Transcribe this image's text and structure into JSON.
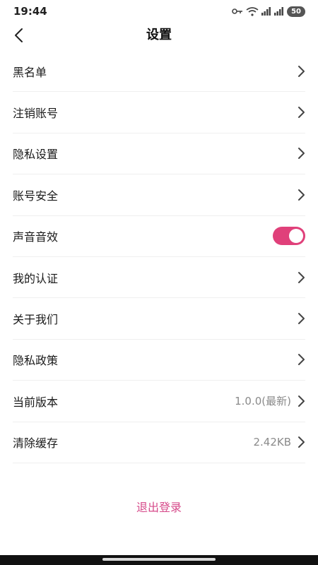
{
  "status_bar": {
    "time": "19:44",
    "battery": "50"
  },
  "nav": {
    "title": "设置"
  },
  "settings": {
    "items": [
      {
        "label": "黑名单"
      },
      {
        "label": "注销账号"
      },
      {
        "label": "隐私设置"
      },
      {
        "label": "账号安全"
      },
      {
        "label": "声音音效",
        "toggle_on": true
      },
      {
        "label": "我的认证"
      },
      {
        "label": "关于我们"
      },
      {
        "label": "隐私政策"
      },
      {
        "label": "当前版本",
        "value": "1.0.0(最新)"
      },
      {
        "label": "清除缓存",
        "value": "2.42KB"
      }
    ]
  },
  "logout": {
    "label": "退出登录"
  },
  "colors": {
    "accent": "#e0407a",
    "logout_text": "#d64a8a",
    "divider": "#efefef",
    "value_text": "#8a8a8a"
  },
  "icons": {
    "back": "back-arrow-icon",
    "row_arrow": "chevron-right-icon"
  }
}
